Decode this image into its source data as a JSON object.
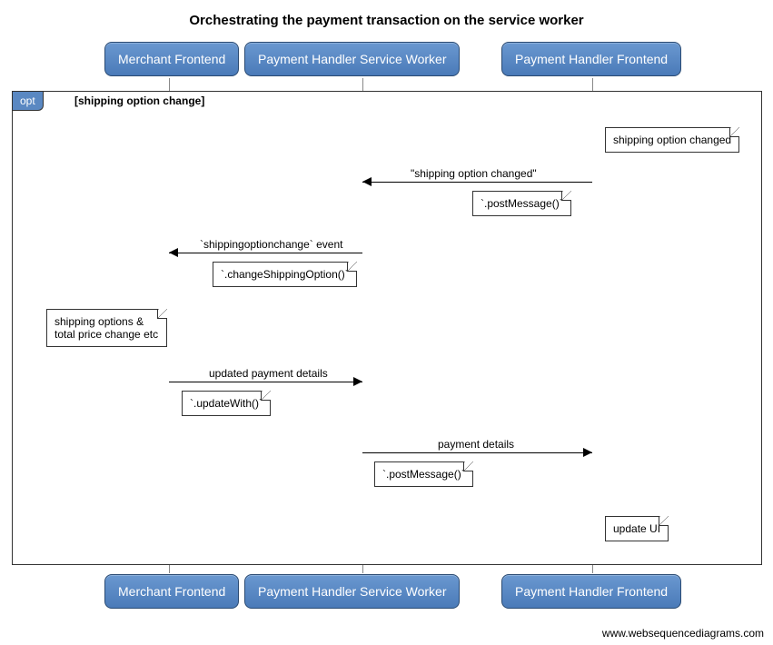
{
  "title": "Orchestrating the payment transaction on the service worker",
  "participants": {
    "merchant": "Merchant Frontend",
    "sw": "Payment Handler Service Worker",
    "frontend": "Payment Handler Frontend"
  },
  "opt": {
    "label": "opt",
    "condition": "[shipping option change]"
  },
  "notes": {
    "shipping_changed": "shipping option changed",
    "post_msg_1": "`.postMessage()`",
    "change_opt": "`.changeShippingOption()`",
    "options_total": "shipping options & total price change etc",
    "update_with": "`.updateWith()`",
    "post_msg_2": "`.postMessage()`",
    "update_ui": "update UI"
  },
  "messages": {
    "m1": "\"shipping option changed\"",
    "m2": "`shippingoptionchange` event",
    "m3": "updated payment details",
    "m4": "payment details"
  },
  "credit": "www.websequencediagrams.com",
  "chart_data": {
    "type": "sequence_diagram",
    "title": "Orchestrating the payment transaction on the service worker",
    "participants": [
      "Merchant Frontend",
      "Payment Handler Service Worker",
      "Payment Handler Frontend"
    ],
    "fragments": [
      {
        "type": "opt",
        "guard": "shipping option change",
        "contents": [
          {
            "type": "note",
            "over": "Payment Handler Frontend",
            "text": "shipping option changed"
          },
          {
            "type": "message",
            "from": "Payment Handler Frontend",
            "to": "Payment Handler Service Worker",
            "label": "\"shipping option changed\""
          },
          {
            "type": "note",
            "over": "Payment Handler Frontend",
            "text": "`.postMessage()`"
          },
          {
            "type": "message",
            "from": "Payment Handler Service Worker",
            "to": "Merchant Frontend",
            "label": "`shippingoptionchange` event"
          },
          {
            "type": "note",
            "over": "Payment Handler Service Worker",
            "text": "`.changeShippingOption()`"
          },
          {
            "type": "note",
            "over": "Merchant Frontend",
            "text": "shipping options & total price change etc"
          },
          {
            "type": "message",
            "from": "Merchant Frontend",
            "to": "Payment Handler Service Worker",
            "label": "updated payment details"
          },
          {
            "type": "note",
            "over": "Merchant Frontend",
            "text": "`.updateWith()`"
          },
          {
            "type": "message",
            "from": "Payment Handler Service Worker",
            "to": "Payment Handler Frontend",
            "label": "payment details"
          },
          {
            "type": "note",
            "over": "Payment Handler Service Worker",
            "text": "`.postMessage()`"
          },
          {
            "type": "note",
            "over": "Payment Handler Frontend",
            "text": "update UI"
          }
        ]
      }
    ]
  }
}
